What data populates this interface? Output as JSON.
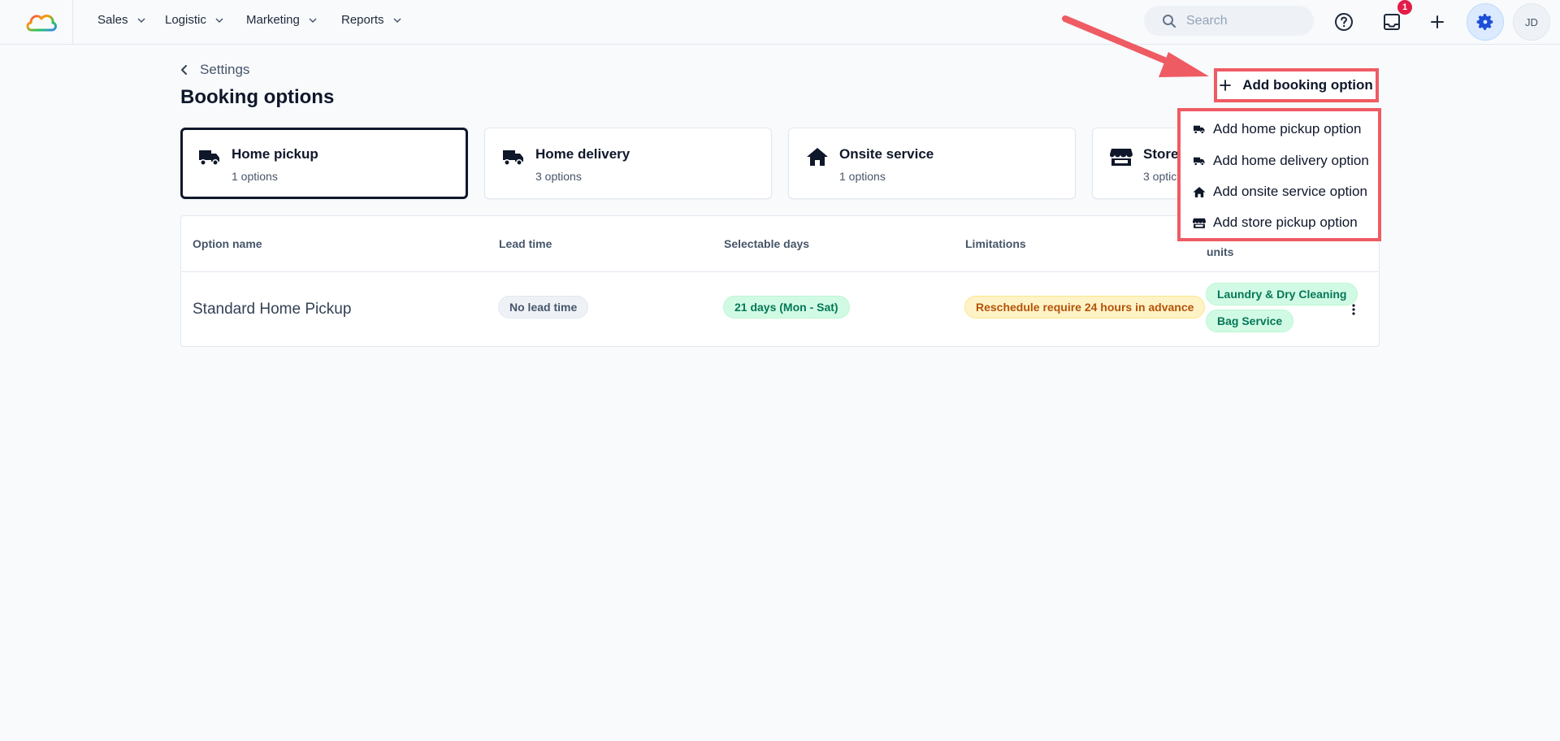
{
  "nav": {
    "items": [
      {
        "label": "Sales"
      },
      {
        "label": "Logistic"
      },
      {
        "label": "Marketing"
      },
      {
        "label": "Reports"
      }
    ],
    "search_placeholder": "Search",
    "notification_count": "1",
    "avatar_initials": "JD"
  },
  "breadcrumb": {
    "label": "Settings"
  },
  "page": {
    "title": "Booking options"
  },
  "add_button": {
    "label": "Add booking option"
  },
  "cards": [
    {
      "title": "Home pickup",
      "subtitle": "1 options",
      "icon": "truck-icon",
      "active": true
    },
    {
      "title": "Home delivery",
      "subtitle": "3 options",
      "icon": "truck-icon"
    },
    {
      "title": "Onsite service",
      "subtitle": "1 options",
      "icon": "home-icon"
    },
    {
      "title": "Store",
      "subtitle": "3 optic",
      "icon": "store-icon"
    }
  ],
  "table": {
    "headers": [
      "Option name",
      "Lead time",
      "Selectable days",
      "Limitations",
      "units"
    ],
    "rows": [
      {
        "name": "Standard Home Pickup",
        "lead_time": "No lead time",
        "selectable_days": "21 days (Mon - Sat)",
        "limitation": "Reschedule require 24 hours in advance",
        "units": [
          "Laundry & Dry Cleaning",
          "Bag Service"
        ]
      }
    ]
  },
  "dropdown": {
    "items": [
      {
        "label": "Add home pickup option",
        "icon": "truck-icon"
      },
      {
        "label": "Add home delivery option",
        "icon": "truck-icon"
      },
      {
        "label": "Add onsite service option",
        "icon": "home-icon"
      },
      {
        "label": "Add store pickup option",
        "icon": "store-icon"
      }
    ]
  },
  "colors": {
    "accent_red": "#ef5b63",
    "gear_blue": "#1d4ed8",
    "badge_red": "#e11d48",
    "text_dark": "#0f172a"
  }
}
